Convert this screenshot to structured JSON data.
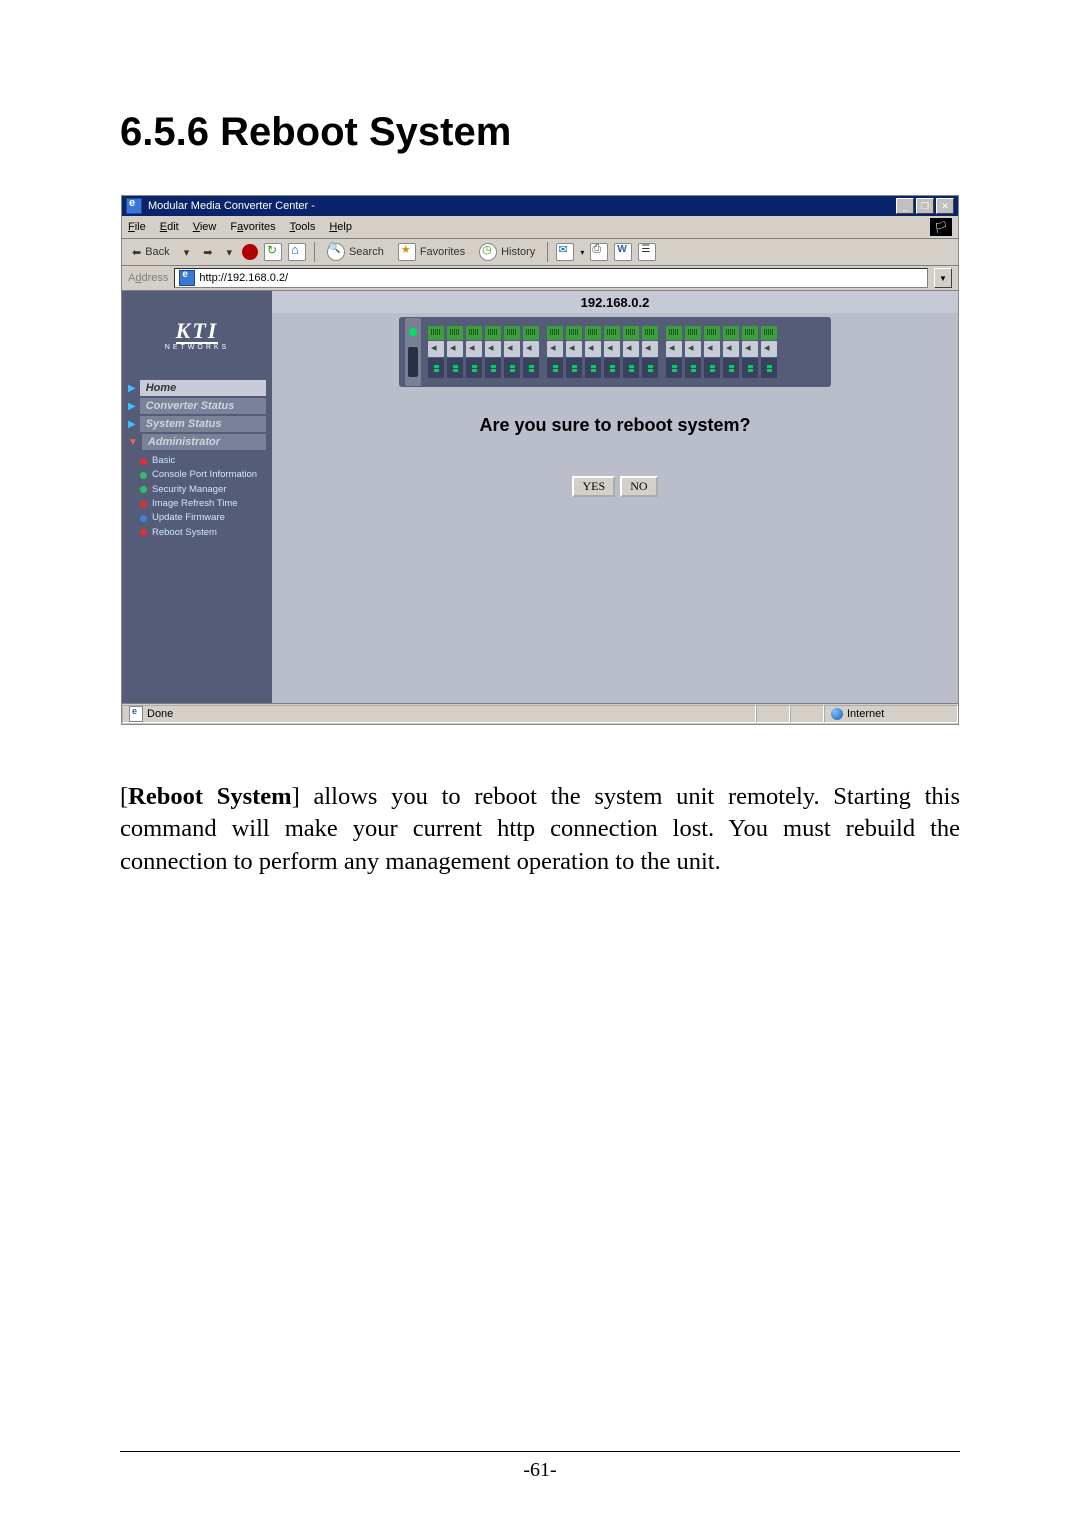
{
  "section": {
    "number": "6.5.6",
    "title": "Reboot System"
  },
  "browser": {
    "title": "Modular Media Converter Center -",
    "menus": [
      "File",
      "Edit",
      "View",
      "Favorites",
      "Tools",
      "Help"
    ],
    "toolbar": {
      "back": "Back",
      "search": "Search",
      "favorites": "Favorites",
      "history": "History"
    },
    "address_label": "Address",
    "url": "http://192.168.0.2/",
    "status_left": "Done",
    "status_right": "Internet"
  },
  "app": {
    "logo": "KTI",
    "logo_sub": "NETWORKS",
    "ip": "192.168.0.2",
    "nav": {
      "home": "Home",
      "converter": "Converter Status",
      "system": "System Status",
      "admin": "Administrator",
      "sub": {
        "basic": "Basic",
        "console": "Console Port Information",
        "security": "Security Manager",
        "refresh": "Image Refresh Time",
        "firmware": "Update Firmware",
        "reboot": "Reboot System"
      }
    },
    "prompt": "Are you sure to reboot system?",
    "yes": "YES",
    "no": "NO"
  },
  "paragraph": {
    "lead": "Reboot System",
    "rest": " allows you to reboot the system unit remotely. Starting this command will make your current http connection lost. You must rebuild the connection to perform any management operation to the unit."
  },
  "page_number": "-61-"
}
